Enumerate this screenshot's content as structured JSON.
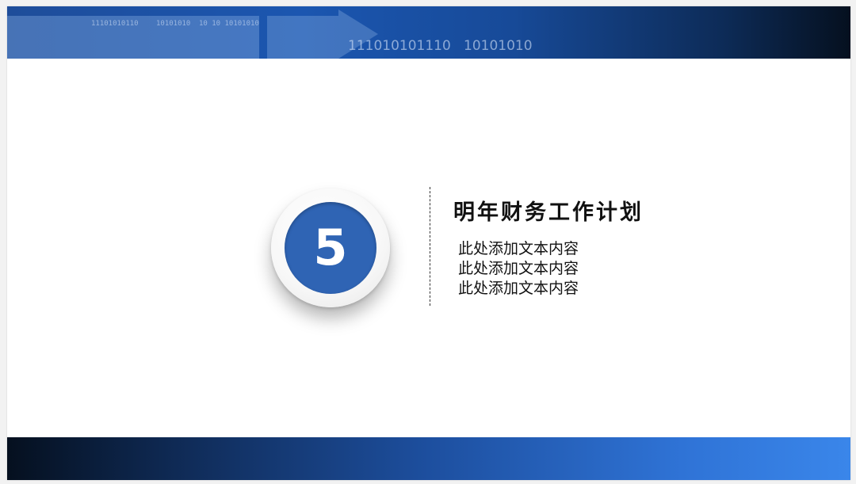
{
  "header": {
    "binary_small": [
      "11101010110",
      "10101010",
      "10 10 10101010"
    ],
    "binary_big": [
      "111010101110",
      "10101010"
    ]
  },
  "badge": {
    "number": "5"
  },
  "content": {
    "title": "明年财务工作计划",
    "lines": [
      "此处添加文本内容",
      "此处添加文本内容",
      "此处添加文本内容"
    ]
  },
  "colors": {
    "accent_blue": "#2f64b4",
    "band_dark": "#05101f",
    "band_light": "#3a86ea"
  }
}
